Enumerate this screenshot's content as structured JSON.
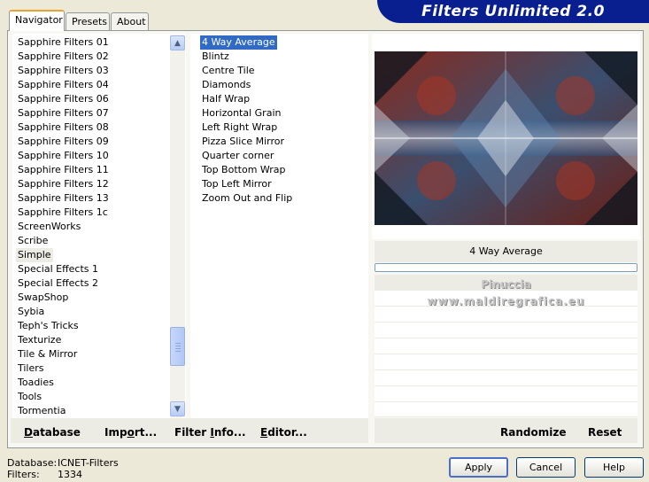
{
  "tabs": [
    {
      "label": "Navigator",
      "active": true
    },
    {
      "label": "Presets",
      "active": false
    },
    {
      "label": "About",
      "active": false
    }
  ],
  "banner_title": "Filters Unlimited 2.0",
  "categories": [
    "Sapphire Filters 01",
    "Sapphire Filters 02",
    "Sapphire Filters 03",
    "Sapphire Filters 04",
    "Sapphire Filters 06",
    "Sapphire Filters 07",
    "Sapphire Filters 08",
    "Sapphire Filters 09",
    "Sapphire Filters 10",
    "Sapphire Filters 11",
    "Sapphire Filters 12",
    "Sapphire Filters 13",
    "Sapphire Filters 1c",
    "ScreenWorks",
    "Scribe",
    "Simple",
    "Special Effects 1",
    "Special Effects 2",
    "SwapShop",
    "Sybia",
    "Teph's Tricks",
    "Texturize",
    "Tile & Mirror",
    "Tilers",
    "Toadies",
    "Tools",
    "Tormentia"
  ],
  "selected_category": "Simple",
  "filters": [
    "4 Way Average",
    "Blintz",
    "Centre Tile",
    "Diamonds",
    "Half Wrap",
    "Horizontal Grain",
    "Left Right Wrap",
    "Pizza Slice Mirror",
    "Quarter corner",
    "Top Bottom Wrap",
    "Top Left Mirror",
    "Zoom Out and Flip"
  ],
  "selected_filter": "4 Way Average",
  "preview_filter_name": "4 Way Average",
  "watermark": {
    "line1": "Pinuccia",
    "line2": "www.maldiregrafica.eu"
  },
  "left_buttons": {
    "database": {
      "underline": "D",
      "rest": "atabase"
    },
    "import": {
      "pre": "Imp",
      "underline": "o",
      "rest": "rt..."
    },
    "filter_info": {
      "pre": "Filter ",
      "underline": "I",
      "rest": "nfo..."
    },
    "editor": {
      "underline": "E",
      "rest": "ditor..."
    }
  },
  "randomize_label": "Randomize",
  "reset_label": "Reset",
  "status": {
    "database_label": "Database:",
    "database_value": "ICNET-Filters",
    "filters_label": "Filters:",
    "filters_value": "1334"
  },
  "apply_label": "Apply",
  "cancel_label": "Cancel",
  "help_label": "Help",
  "icons": [
    "scroll-up-icon",
    "scroll-down-icon"
  ],
  "colors": {
    "banner": "#0a1f8f",
    "selection": "#316ac5",
    "tab_highlight": "#e8a32c"
  }
}
